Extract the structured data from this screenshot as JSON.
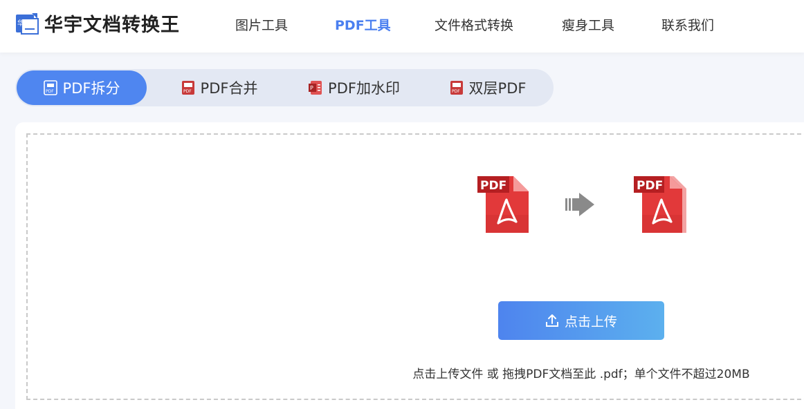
{
  "header": {
    "logo_text": "华宇文档转换王",
    "logo_icon": "huayu-logo-icon",
    "nav": [
      {
        "label": "图片工具",
        "active": false
      },
      {
        "label": "PDF工具",
        "active": true
      },
      {
        "label": "文件格式转换",
        "active": false
      },
      {
        "label": "瘦身工具",
        "active": false
      },
      {
        "label": "联系我们",
        "active": false
      }
    ]
  },
  "tabs": [
    {
      "label": "PDF拆分",
      "icon": "pdf-split-icon",
      "active": true
    },
    {
      "label": "PDF合并",
      "icon": "pdf-merge-icon",
      "active": false
    },
    {
      "label": "PDF加水印",
      "icon": "pdf-watermark-icon",
      "active": false
    },
    {
      "label": "双层PDF",
      "icon": "pdf-double-layer-icon",
      "active": false
    }
  ],
  "upload": {
    "source_icon_label": "PDF",
    "target_icon_label": "PDF",
    "button_label": "点击上传",
    "hint": "点击上传文件 或 拖拽PDF文档至此 .pdf；单个文件不超过20MB"
  },
  "colors": {
    "accent": "#4f86f0",
    "pdf_red": "#e2393a",
    "tab_bg": "#e3e8f3"
  }
}
